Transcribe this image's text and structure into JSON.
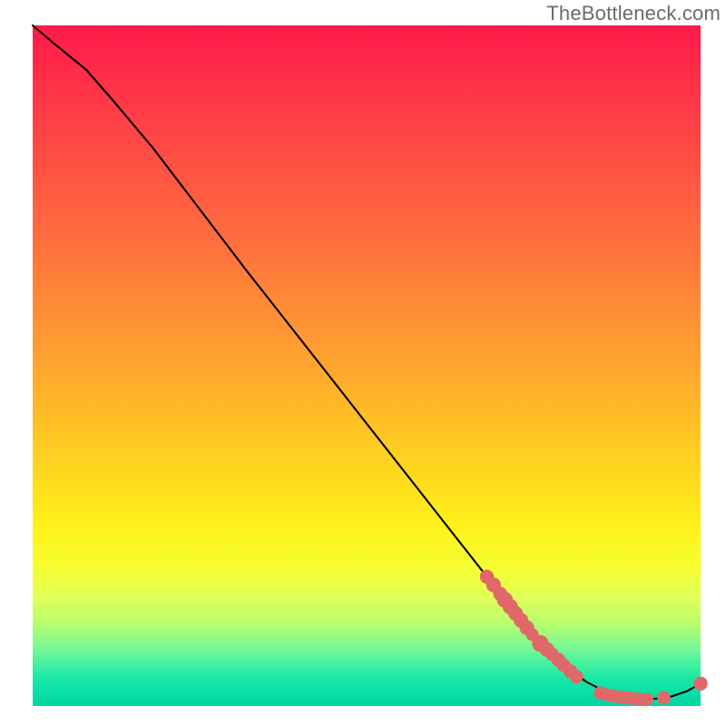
{
  "watermark": "TheBottleneck.com",
  "colors": {
    "dot": "#e06868",
    "curve": "#000000"
  },
  "chart_data": {
    "type": "line",
    "title": "",
    "xlabel": "",
    "ylabel": "",
    "xlim": [
      0,
      100
    ],
    "ylim": [
      0,
      100
    ],
    "grid": false,
    "legend": false,
    "series": [
      {
        "name": "curve",
        "x": [
          0,
          3,
          8,
          12,
          18,
          25,
          32,
          40,
          48,
          56,
          62,
          68,
          72,
          75,
          78,
          80,
          83,
          86,
          89,
          92,
          95,
          98,
          100
        ],
        "y": [
          100,
          97.5,
          93.5,
          89,
          82,
          73,
          64,
          54,
          44,
          34,
          26.5,
          19,
          14,
          10.5,
          7.5,
          5.5,
          3.5,
          2,
          1.2,
          1.0,
          1.2,
          2.2,
          3.3
        ]
      }
    ],
    "scatter": [
      {
        "name": "cluster-diagonal",
        "points": [
          {
            "x": 68,
            "y": 19.0,
            "r": 1.05
          },
          {
            "x": 69,
            "y": 17.8,
            "r": 1.1
          },
          {
            "x": 70,
            "y": 16.5,
            "r": 1.05
          },
          {
            "x": 70.7,
            "y": 15.6,
            "r": 1.2
          },
          {
            "x": 71.5,
            "y": 14.6,
            "r": 1.15
          },
          {
            "x": 72.3,
            "y": 13.6,
            "r": 1.1
          },
          {
            "x": 73.1,
            "y": 12.6,
            "r": 1.1
          },
          {
            "x": 74.0,
            "y": 11.5,
            "r": 1.1
          },
          {
            "x": 74.8,
            "y": 10.5,
            "r": 0.95
          },
          {
            "x": 76.0,
            "y": 9.2,
            "r": 1.25
          },
          {
            "x": 77.0,
            "y": 8.3,
            "r": 1.1
          },
          {
            "x": 77.8,
            "y": 7.6,
            "r": 1.0
          },
          {
            "x": 78.7,
            "y": 6.8,
            "r": 1.05
          },
          {
            "x": 79.5,
            "y": 6.0,
            "r": 1.0
          },
          {
            "x": 80.5,
            "y": 5.1,
            "r": 1.05
          },
          {
            "x": 81.4,
            "y": 4.3,
            "r": 1.0
          }
        ]
      },
      {
        "name": "cluster-trough",
        "points": [
          {
            "x": 85.0,
            "y": 1.9,
            "r": 1.0
          },
          {
            "x": 85.8,
            "y": 1.7,
            "r": 0.95
          },
          {
            "x": 86.7,
            "y": 1.5,
            "r": 1.0
          },
          {
            "x": 87.5,
            "y": 1.4,
            "r": 0.95
          },
          {
            "x": 88.3,
            "y": 1.3,
            "r": 0.95
          },
          {
            "x": 89.2,
            "y": 1.2,
            "r": 1.0
          },
          {
            "x": 90.1,
            "y": 1.1,
            "r": 0.95
          },
          {
            "x": 91.0,
            "y": 1.0,
            "r": 0.95
          },
          {
            "x": 92.0,
            "y": 1.0,
            "r": 0.95
          },
          {
            "x": 94.5,
            "y": 1.2,
            "r": 1.0
          }
        ]
      },
      {
        "name": "tail-point",
        "points": [
          {
            "x": 100.0,
            "y": 3.3,
            "r": 1.05
          }
        ]
      }
    ]
  }
}
